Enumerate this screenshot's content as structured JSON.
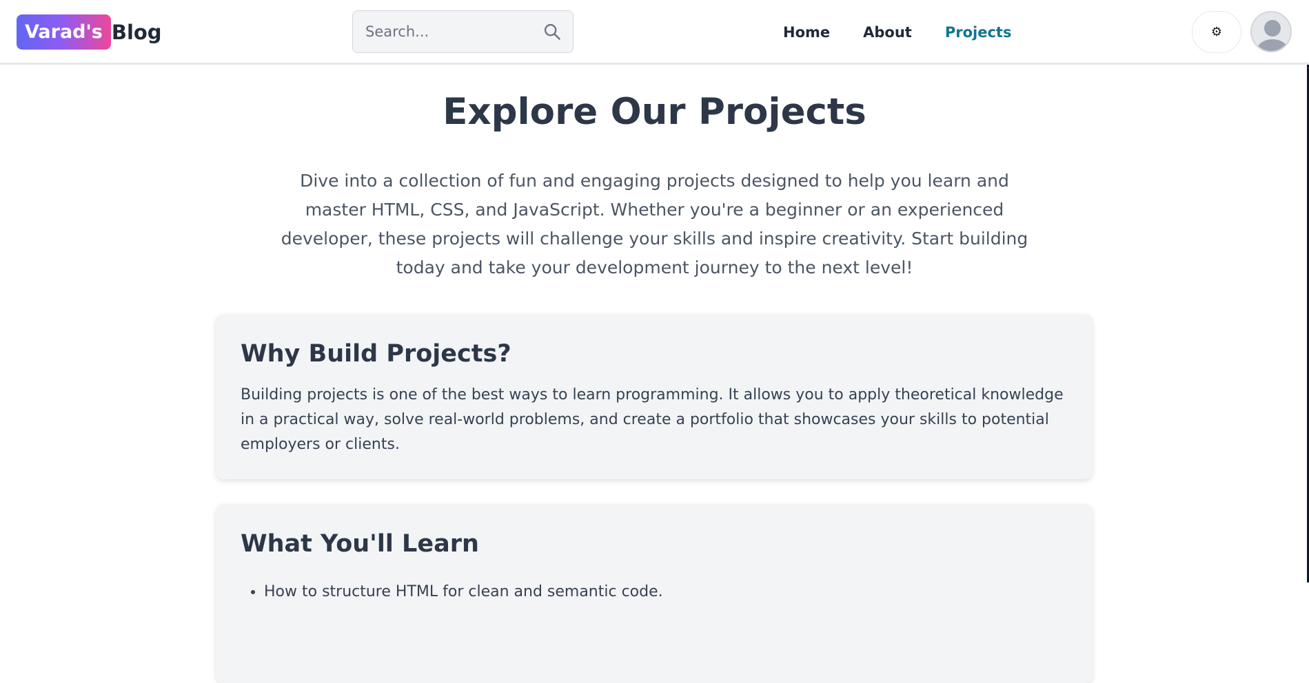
{
  "header": {
    "brand_chip": "Varad's",
    "brand_text": "Blog",
    "search_placeholder": "Search...",
    "nav": [
      {
        "label": "Home",
        "active": false
      },
      {
        "label": "About",
        "active": false
      },
      {
        "label": "Projects",
        "active": true
      }
    ],
    "theme_toggle_icon": "gear-icon",
    "colors": {
      "brand_gradient_start": "#6366f1",
      "brand_gradient_end": "#ec4899",
      "active_nav": "#0e7490"
    }
  },
  "main": {
    "title": "Explore Our Projects",
    "intro": "Dive into a collection of fun and engaging projects designed to help you learn and master HTML, CSS, and JavaScript. Whether you're a beginner or an experienced developer, these projects will challenge your skills and inspire creativity. Start building today and take your development journey to the next level!",
    "cards": [
      {
        "heading": "Why Build Projects?",
        "body": "Building projects is one of the best ways to learn programming. It allows you to apply theoretical knowledge in a practical way, solve real-world problems, and create a portfolio that showcases your skills to potential employers or clients."
      },
      {
        "heading": "What You'll Learn",
        "items": [
          "How to structure HTML for clean and semantic code."
        ]
      }
    ]
  }
}
